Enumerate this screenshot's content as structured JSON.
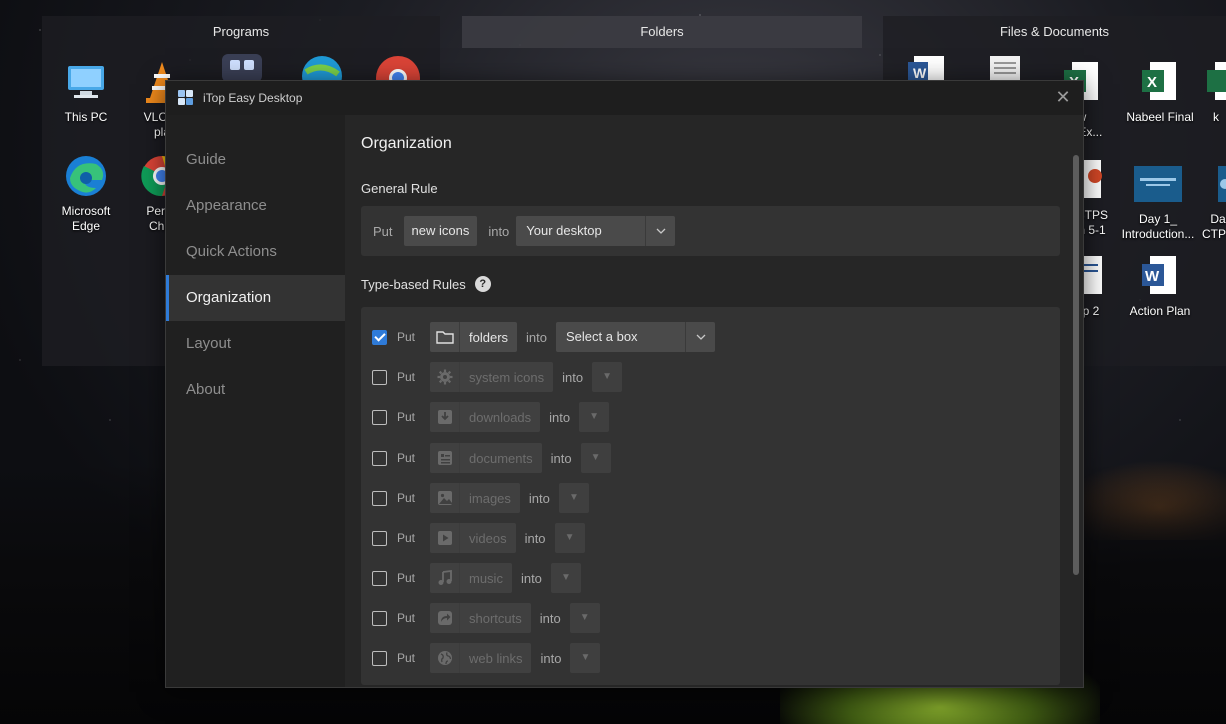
{
  "desktop": {
    "fences": {
      "programs": "Programs",
      "folders": "Folders",
      "files": "Files & Documents"
    },
    "icons": [
      {
        "label": "This PC"
      },
      {
        "label": "VLC m",
        "label2": "pla"
      },
      {
        "label": "Microsoft",
        "label2": "Edge"
      },
      {
        "label": "Perso",
        "label2": "Chro"
      },
      {
        "label": "w",
        "label2": "oft Ex..."
      },
      {
        "label": "Nabeel Final"
      },
      {
        "label": "k"
      },
      {
        "label": "CTPS",
        "label2": "n 5-1"
      },
      {
        "label": "Day 1_",
        "label2": "Introduction..."
      },
      {
        "label": "Da",
        "label2": "CTPS"
      },
      {
        "label": "p 2"
      },
      {
        "label": "Action Plan"
      }
    ]
  },
  "window": {
    "title": "iTop Easy Desktop",
    "close_glyph": "✕"
  },
  "sidebar": {
    "items": [
      {
        "label": "Guide"
      },
      {
        "label": "Appearance"
      },
      {
        "label": "Quick Actions"
      },
      {
        "label": "Organization",
        "active": true
      },
      {
        "label": "Layout"
      },
      {
        "label": "About"
      }
    ]
  },
  "main": {
    "title": "Organization",
    "general_rule": {
      "heading": "General Rule",
      "put": "Put",
      "chip": "new icons",
      "into": "into",
      "destination": "Your desktop"
    },
    "type_rules": {
      "heading": "Type-based Rules",
      "help": "?",
      "put": "Put",
      "into": "into",
      "select_placeholder": "Select a box",
      "rules": [
        {
          "type": "folders",
          "icon": "folder-icon",
          "checked": true
        },
        {
          "type": "system icons",
          "icon": "gear-icon",
          "checked": false
        },
        {
          "type": "downloads",
          "icon": "download-icon",
          "checked": false
        },
        {
          "type": "documents",
          "icon": "document-icon",
          "checked": false
        },
        {
          "type": "images",
          "icon": "image-icon",
          "checked": false
        },
        {
          "type": "videos",
          "icon": "video-icon",
          "checked": false
        },
        {
          "type": "music",
          "icon": "music-icon",
          "checked": false
        },
        {
          "type": "shortcuts",
          "icon": "shortcut-icon",
          "checked": false
        },
        {
          "type": "web links",
          "icon": "globe-icon",
          "checked": false
        }
      ]
    }
  },
  "colors": {
    "accent": "#2f7bd8"
  }
}
